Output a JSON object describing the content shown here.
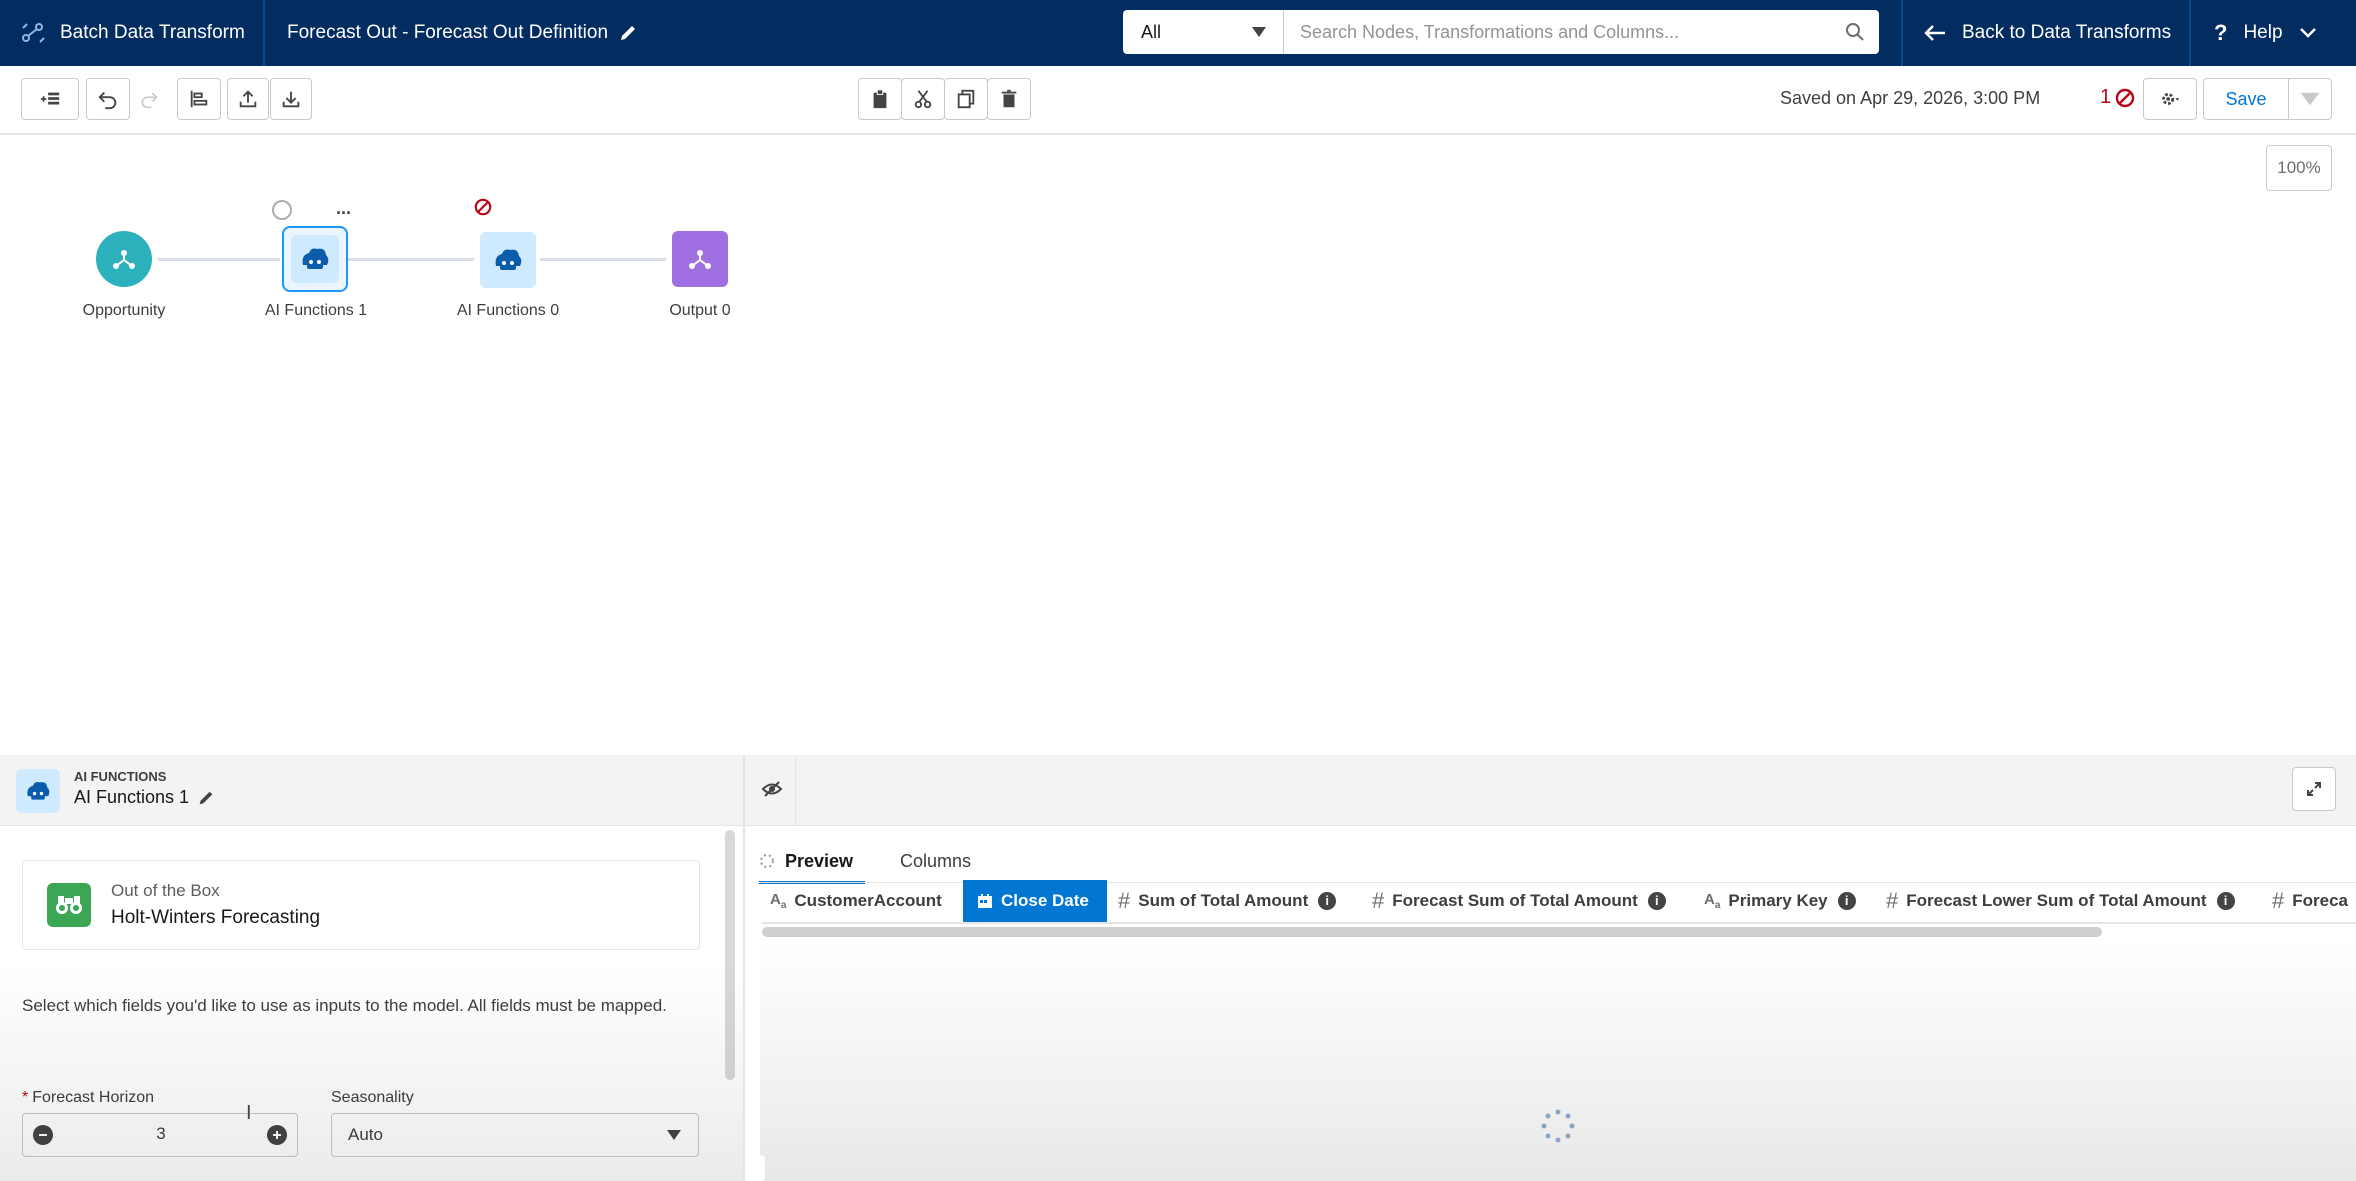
{
  "topbar": {
    "app_title": "Batch Data Transform",
    "recipe_title": "Forecast Out - Forecast Out Definition",
    "search_scope": "All",
    "search_placeholder": "Search Nodes, Transformations and Columns...",
    "back_label": "Back to Data Transforms",
    "help_label": "Help"
  },
  "toolbar": {
    "saved_text": "Saved on Apr 29, 2026, 3:00 PM",
    "error_count": "1",
    "save_label": "Save",
    "zoom": "100%"
  },
  "canvas": {
    "nodes": [
      {
        "label": "Opportunity",
        "icon": "input-icon",
        "color": "#2cb1bc"
      },
      {
        "label": "AI Functions 1",
        "icon": "ai-icon",
        "color": "#0176d3"
      },
      {
        "label": "AI Functions 0",
        "icon": "ai-icon",
        "color": "#0176d3"
      },
      {
        "label": "Output 0",
        "icon": "output-icon",
        "color": "#9f6ee0"
      }
    ],
    "node_menu": "..."
  },
  "panel": {
    "type_label": "AI FUNCTIONS",
    "node_name": "AI Functions 1",
    "model_category": "Out of the Box",
    "model_name": "Holt-Winters Forecasting",
    "instructions": "Select which fields you'd like to use as inputs to the model. All fields must be mapped.",
    "forecast_horizon_label": "Forecast Horizon",
    "forecast_horizon_required": "*",
    "forecast_horizon_value": "3",
    "seasonality_label": "Seasonality",
    "seasonality_value": "Auto"
  },
  "preview": {
    "tabs": [
      {
        "label": "Preview",
        "active": true
      },
      {
        "label": "Columns",
        "active": false
      }
    ],
    "columns": [
      {
        "label": "CustomerAccount",
        "type": "text",
        "info": false
      },
      {
        "label": "Close Date",
        "type": "date",
        "info": false,
        "selected": true
      },
      {
        "label": "Sum of Total Amount",
        "type": "number",
        "info": true
      },
      {
        "label": "Forecast Sum of Total Amount",
        "type": "number",
        "info": true
      },
      {
        "label": "Primary Key",
        "type": "text",
        "info": true
      },
      {
        "label": "Forecast Lower Sum of Total Amount",
        "type": "number",
        "info": true
      },
      {
        "label": "Foreca",
        "type": "number",
        "info": false
      }
    ]
  },
  "colors": {
    "header": "#032d60",
    "accent": "#0176d3",
    "error": "#ba0517"
  }
}
